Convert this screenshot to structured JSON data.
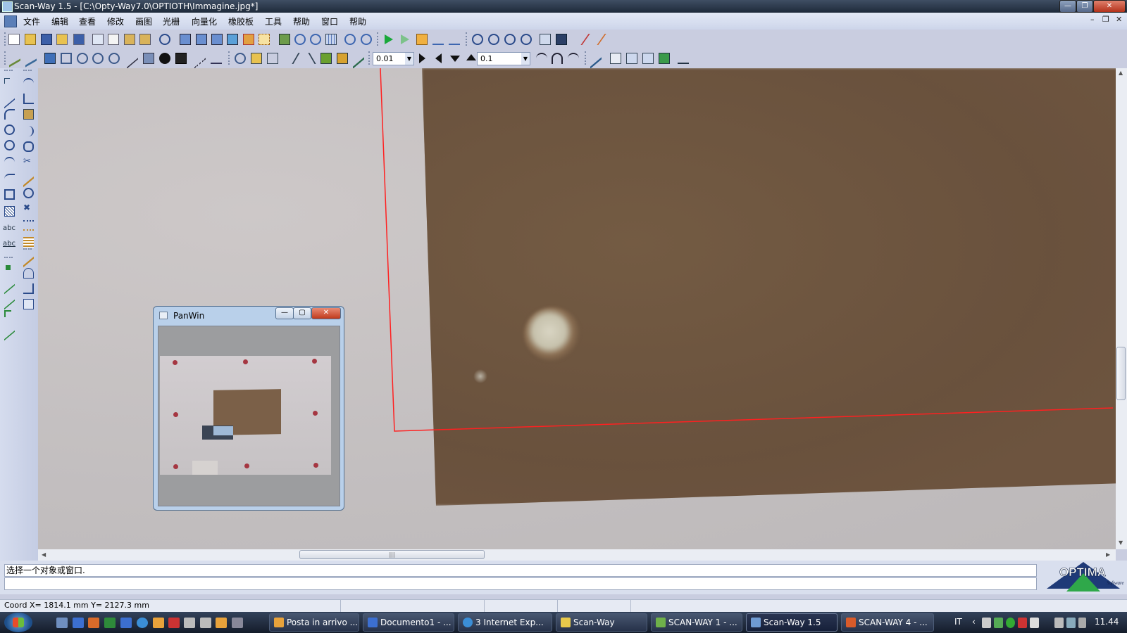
{
  "window": {
    "title": "Scan-Way 1.5 - [C:\\Opty-Way7.0\\OPTIOTH\\Immagine.jpg*]",
    "controls": {
      "minimize": "—",
      "maximize": "❐",
      "close": "✕"
    }
  },
  "menu": {
    "items": [
      "文件",
      "编辑",
      "查看",
      "修改",
      "画图",
      "光栅",
      "向量化",
      "橡胶板",
      "工具",
      "帮助",
      "窗口",
      "帮助"
    ],
    "mdi_controls": [
      "–",
      "❐",
      "✕"
    ]
  },
  "toolbar2": {
    "combo1_value": "0.01",
    "combo2_value": "0.1"
  },
  "lefttools": {
    "text_tool_label": "abc",
    "text_tool2_label": "abc"
  },
  "panwin": {
    "title": "PanWin",
    "close_glyph": "✕",
    "max_glyph": "▢",
    "min_glyph": "—"
  },
  "hscroll": {
    "grip": "|||"
  },
  "command": {
    "prompt": "选择一个对象或窗口.",
    "input": ""
  },
  "logo": {
    "brand": "OPTIMA",
    "sub": "Software"
  },
  "status": {
    "coord": "Coord  X= 1814.1 mm  Y= 2127.3 mm"
  },
  "taskbar": {
    "tasks": [
      {
        "label": "Posta in arrivo ...",
        "color": "#e8a23b"
      },
      {
        "label": "Documento1 - ...",
        "color": "#3c6fd0"
      },
      {
        "label": "3 Internet Exp...",
        "color": "#3b8ed6"
      },
      {
        "label": "Scan-Way",
        "color": "#e8c94b"
      },
      {
        "label": "SCAN-WAY 1 - ...",
        "color": "#6fb04a"
      },
      {
        "label": "Scan-Way 1.5",
        "color": "#6f9bd3"
      },
      {
        "label": "SCAN-WAY 4 - ...",
        "color": "#d95b2a"
      }
    ],
    "lang": "IT",
    "clock": "11.44"
  },
  "colors": {
    "outline": "#ff2020",
    "titlebar": "#1e2a3a",
    "accent": "#c03a1c"
  }
}
